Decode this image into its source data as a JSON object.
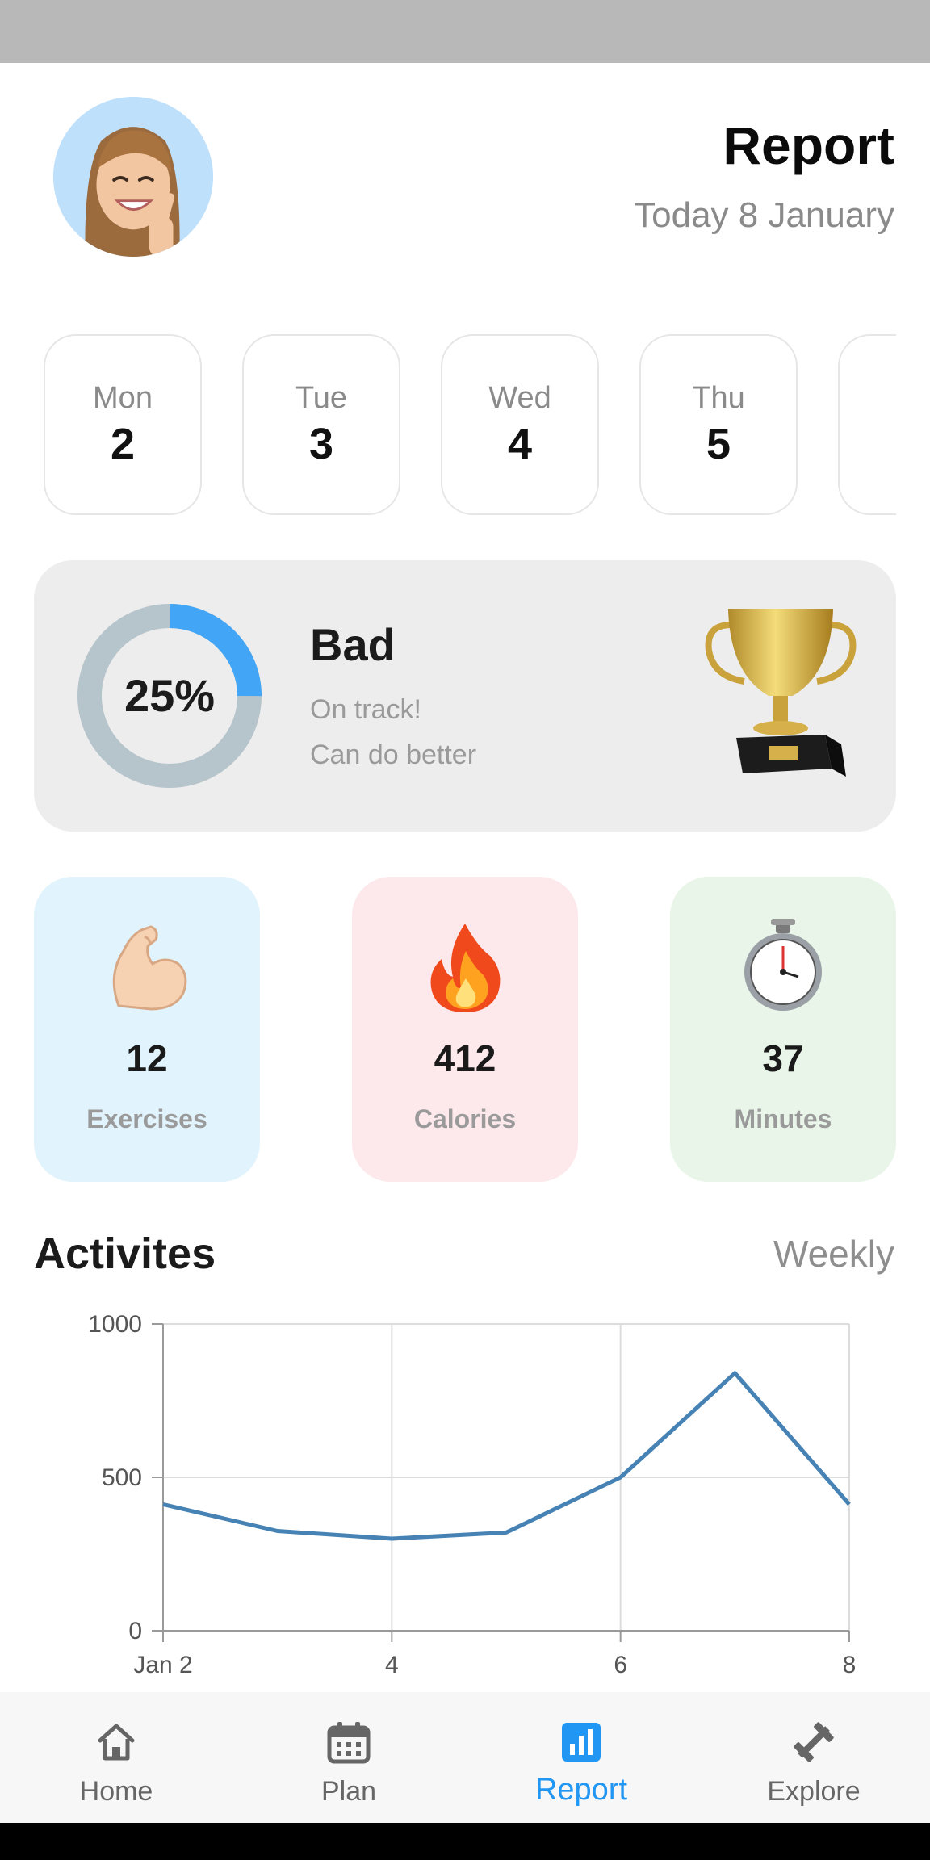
{
  "header": {
    "title": "Report",
    "subtitle": "Today 8 January"
  },
  "days": [
    {
      "name": "Mon",
      "num": "2"
    },
    {
      "name": "Tue",
      "num": "3"
    },
    {
      "name": "Wed",
      "num": "4"
    },
    {
      "name": "Thu",
      "num": "5"
    }
  ],
  "score": {
    "percent": "25%",
    "progress": 0.25,
    "title": "Bad",
    "line1": "On track!",
    "line2": "Can do better",
    "ring_color": "#42a5f5",
    "track_color": "#b6c5cb"
  },
  "stats": [
    {
      "icon": "flexed-biceps-icon",
      "value": "12",
      "label": "Exercises",
      "bg": "#e1f3fc"
    },
    {
      "icon": "fire-icon",
      "value": "412",
      "label": "Calories",
      "bg": "#fde8ec"
    },
    {
      "icon": "stopwatch-icon",
      "value": "37",
      "label": "Minutes",
      "bg": "#e8f5e8"
    }
  ],
  "activities": {
    "title": "Activites",
    "filter": "Weekly"
  },
  "chart_data": {
    "type": "line",
    "x": [
      2,
      3,
      4,
      5,
      6,
      7,
      8
    ],
    "xticks": [
      {
        "x": 2,
        "label": "Jan 2"
      },
      {
        "x": 4,
        "label": "4"
      },
      {
        "x": 6,
        "label": "6"
      },
      {
        "x": 8,
        "label": "8"
      }
    ],
    "yticks": [
      0,
      500,
      1000
    ],
    "ylim": [
      0,
      1000
    ],
    "xlim": [
      2,
      8
    ],
    "series": [
      {
        "values": [
          412,
          325,
          300,
          320,
          500,
          840,
          412
        ]
      }
    ],
    "line_color": "#4682b4",
    "grid": true
  },
  "nav": {
    "items": [
      {
        "label": "Home",
        "icon": "home-icon"
      },
      {
        "label": "Plan",
        "icon": "calendar-icon"
      },
      {
        "label": "Report",
        "icon": "bar-chart-icon",
        "active": true
      },
      {
        "label": "Explore",
        "icon": "dumbbell-icon"
      }
    ],
    "active_color": "#2196f3"
  }
}
